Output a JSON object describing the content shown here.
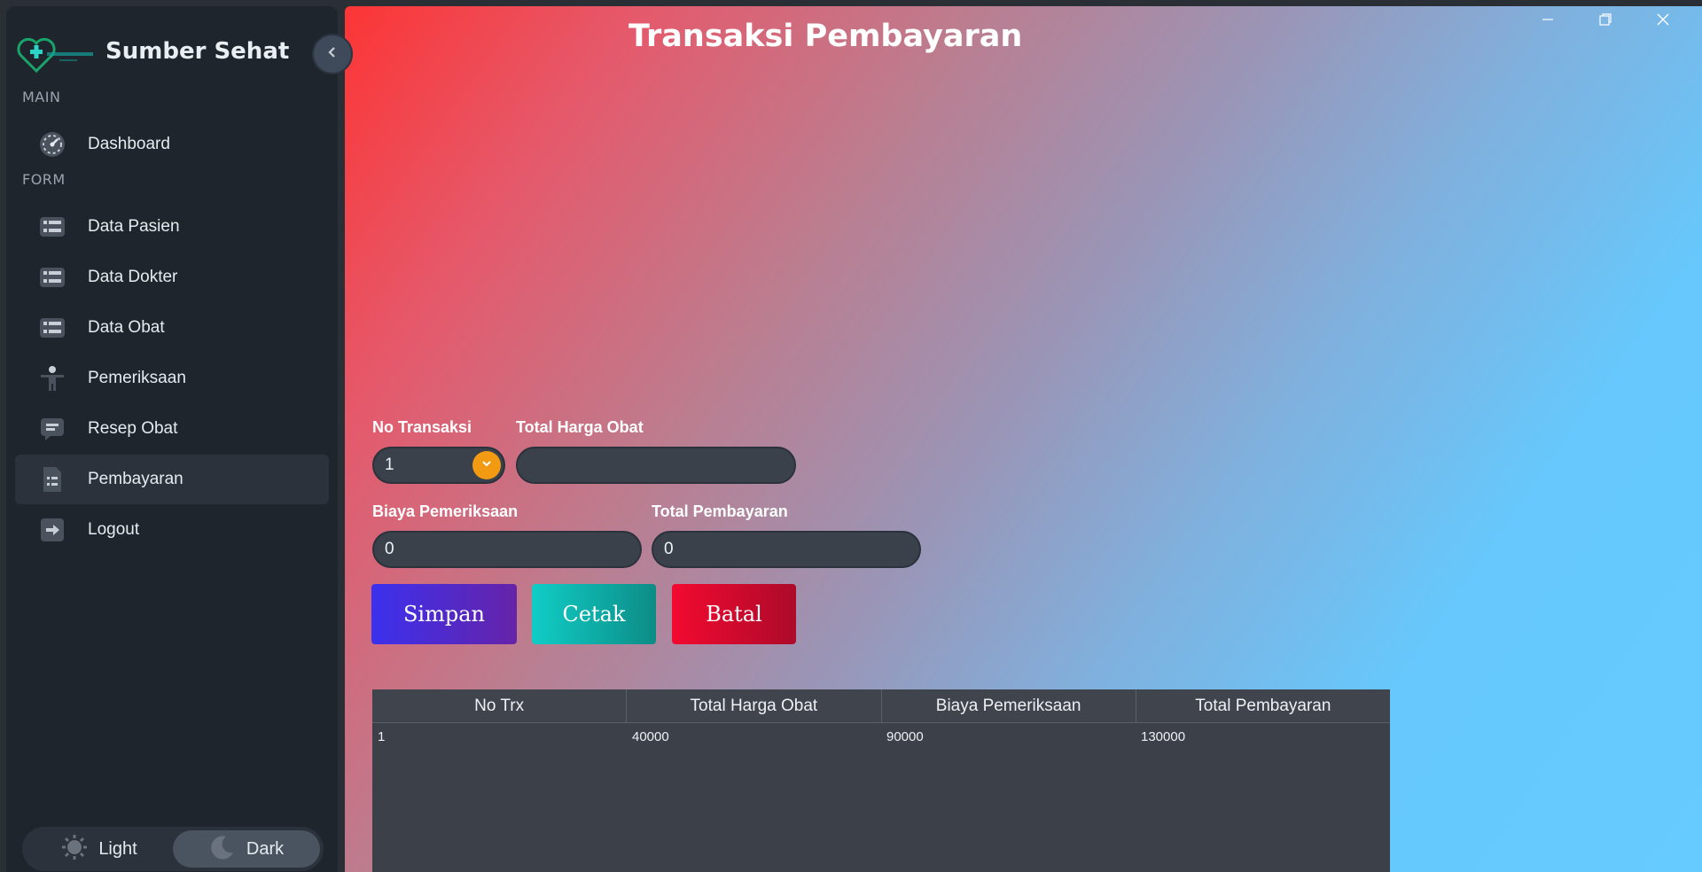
{
  "app": {
    "brand": "Sumber Sehat"
  },
  "sidebar": {
    "sections": {
      "main": "MAIN",
      "form": "FORM"
    },
    "items": [
      {
        "label": "Dashboard",
        "icon": "dashboard-gauge-icon"
      },
      {
        "label": "Data Pasien",
        "icon": "list-icon"
      },
      {
        "label": "Data Dokter",
        "icon": "list-icon"
      },
      {
        "label": "Data Obat",
        "icon": "list-icon"
      },
      {
        "label": "Pemeriksaan",
        "icon": "person-icon"
      },
      {
        "label": "Resep Obat",
        "icon": "message-icon"
      },
      {
        "label": "Pembayaran",
        "icon": "document-list-icon",
        "active": true
      },
      {
        "label": "Logout",
        "icon": "logout-icon"
      }
    ],
    "theme": {
      "light": "Light",
      "dark": "Dark",
      "selected": "Dark"
    }
  },
  "main": {
    "title": "Transaksi Pembayaran",
    "form": {
      "no_transaksi_label": "No Transaksi",
      "no_transaksi_value": "1",
      "total_harga_obat_label": "Total Harga Obat",
      "total_harga_obat_value": "",
      "biaya_pemeriksaan_label": "Biaya Pemeriksaan",
      "biaya_pemeriksaan_value": "0",
      "total_pembayaran_label": "Total Pembayaran",
      "total_pembayaran_value": "0"
    },
    "buttons": {
      "simpan": "Simpan",
      "cetak": "Cetak",
      "batal": "Batal"
    },
    "table": {
      "columns": [
        "No Trx",
        "Total Harga Obat",
        "Biaya Pemeriksaan",
        "Total Pembayaran"
      ],
      "rows": [
        [
          "1",
          "40000",
          "90000",
          "130000"
        ]
      ]
    }
  },
  "colors": {
    "accent_combo": "#f39a13",
    "simpan": "#3b31ee",
    "cetak": "#10cdc6",
    "batal": "#f30a30"
  }
}
